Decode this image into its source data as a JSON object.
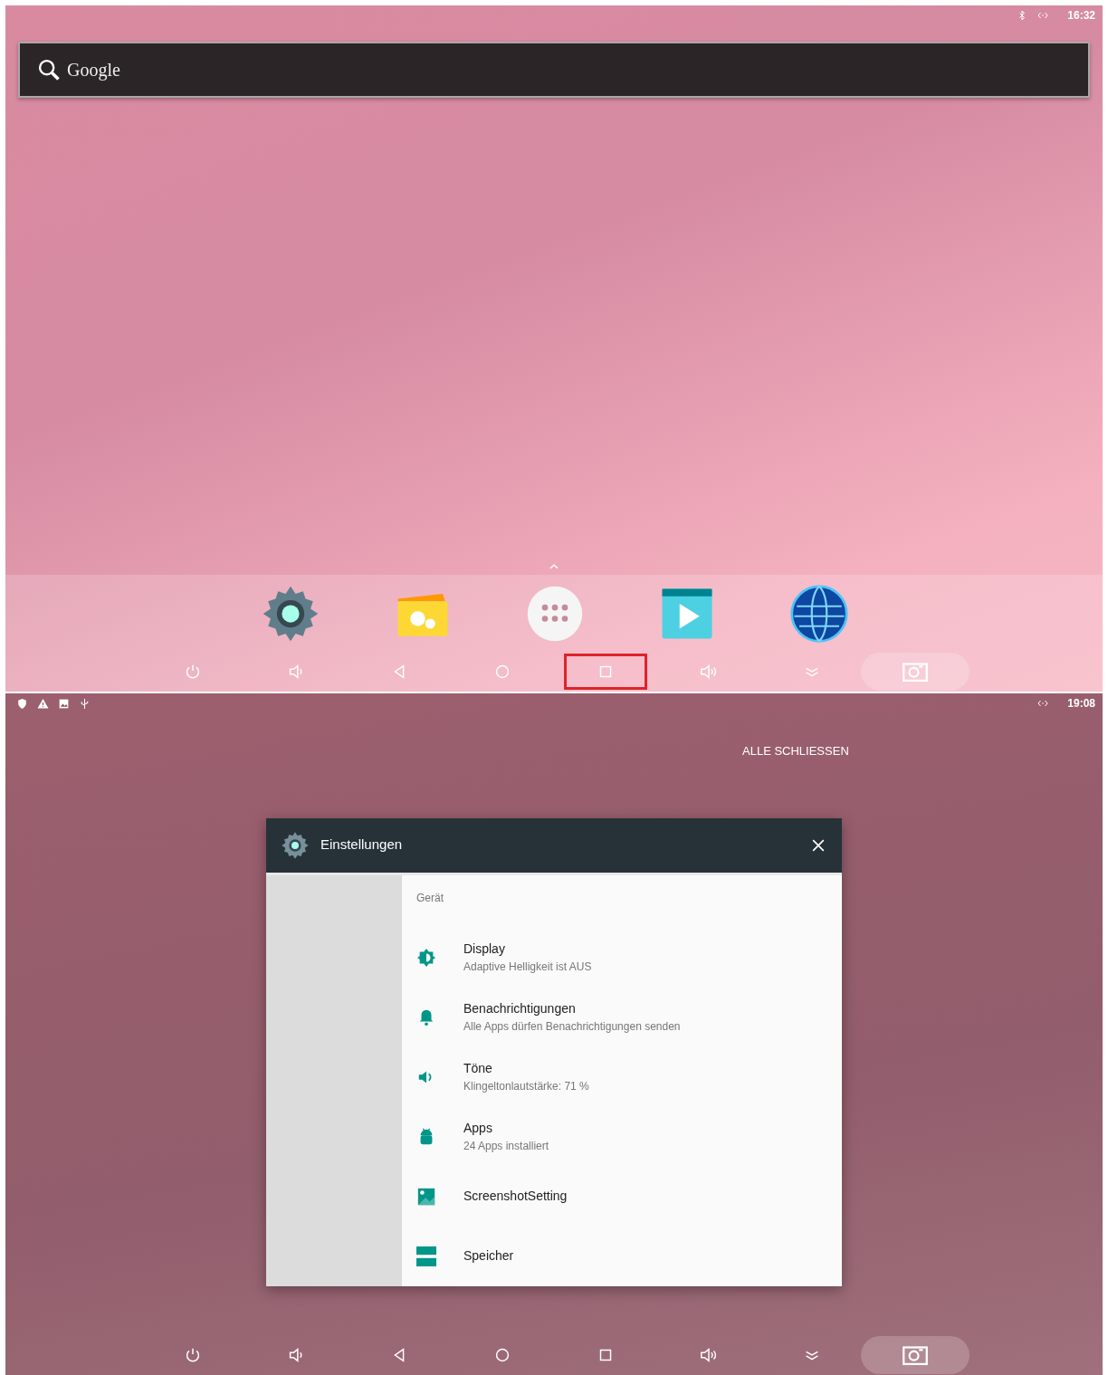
{
  "screens": [
    {
      "kind": "home",
      "status_bar": {
        "time": "16:32"
      },
      "search_bar": {
        "label": "Google"
      },
      "nav_bar": {
        "recents_highlighted": true
      }
    },
    {
      "kind": "recents",
      "status_bar": {
        "time": "19:08"
      },
      "close_all": "ALLE SCHLIESSEN",
      "card": {
        "title": "Einstellungen",
        "section": "Gerät",
        "items": [
          {
            "kind": "brightness",
            "title": "Display",
            "subtitle": "Adaptive Helligkeit ist AUS"
          },
          {
            "kind": "bell",
            "title": "Benachrichtigungen",
            "subtitle": "Alle Apps dürfen Benachrichtigungen senden"
          },
          {
            "kind": "sound",
            "title": "Töne",
            "subtitle": "Klingeltonlautstärke: 71 %"
          },
          {
            "kind": "android",
            "title": "Apps",
            "subtitle": "24 Apps installiert"
          },
          {
            "kind": "image",
            "title": "ScreenshotSetting"
          },
          {
            "kind": "storage",
            "title": "Speicher"
          }
        ]
      },
      "nav_bar": {
        "recents_highlighted": false
      }
    }
  ]
}
